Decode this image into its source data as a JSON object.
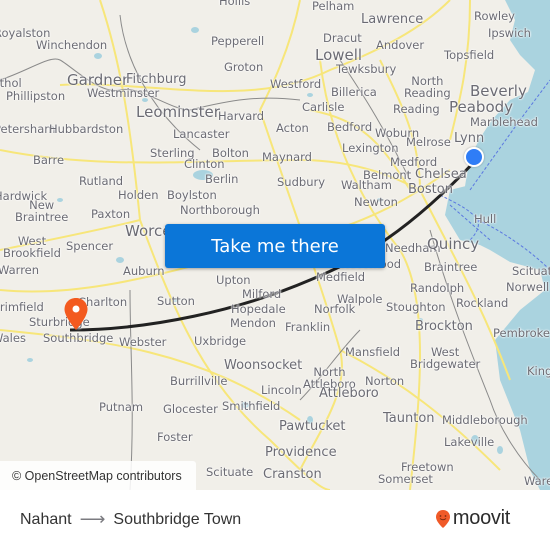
{
  "map": {
    "attribution": "© OpenStreetMap contributors",
    "origin": {
      "name": "Nahant",
      "marker": "blue-dot",
      "color": "#2f7df6"
    },
    "destination": {
      "name": "Southbridge Town",
      "marker": "orange-pin",
      "color": "#f35a1f"
    },
    "route_color": "#222222",
    "water_color": "#aad3df",
    "places": [
      {
        "id": "hollis",
        "label": "Hollis"
      },
      {
        "id": "pelham",
        "label": "Pelham"
      },
      {
        "id": "lawrence",
        "label": "Lawrence"
      },
      {
        "id": "rowley",
        "label": "Rowley"
      },
      {
        "id": "royalston",
        "label": "Royalston"
      },
      {
        "id": "winchendon",
        "label": "Winchendon"
      },
      {
        "id": "pepperell",
        "label": "Pepperell"
      },
      {
        "id": "dracut",
        "label": "Dracut"
      },
      {
        "id": "andover",
        "label": "Andover"
      },
      {
        "id": "ipswich",
        "label": "Ipswich"
      },
      {
        "id": "topsfield",
        "label": "Topsfield"
      },
      {
        "id": "lowell",
        "label": "Lowell"
      },
      {
        "id": "tewksbury",
        "label": "Tewksbury"
      },
      {
        "id": "groton",
        "label": "Groton"
      },
      {
        "id": "gardner",
        "label": "Gardner"
      },
      {
        "id": "fitchburg",
        "label": "Fitchburg"
      },
      {
        "id": "athol",
        "label": "Athol"
      },
      {
        "id": "westminster",
        "label": "Westminster"
      },
      {
        "id": "phillipston",
        "label": "Phillipston"
      },
      {
        "id": "westford",
        "label": "Westford"
      },
      {
        "id": "north-reading",
        "label": "North Reading"
      },
      {
        "id": "billerica",
        "label": "Billerica"
      },
      {
        "id": "beverly",
        "label": "Beverly"
      },
      {
        "id": "peabody",
        "label": "Peabody"
      },
      {
        "id": "carlisle",
        "label": "Carlisle"
      },
      {
        "id": "reading",
        "label": "Reading"
      },
      {
        "id": "leominster",
        "label": "Leominster"
      },
      {
        "id": "harvard",
        "label": "Harvard"
      },
      {
        "id": "marblehead",
        "label": "Marblehead"
      },
      {
        "id": "petersham",
        "label": "Petersham"
      },
      {
        "id": "hubbardston",
        "label": "Hubbardston"
      },
      {
        "id": "lancaster",
        "label": "Lancaster"
      },
      {
        "id": "acton",
        "label": "Acton"
      },
      {
        "id": "bedford",
        "label": "Bedford"
      },
      {
        "id": "woburn",
        "label": "Woburn"
      },
      {
        "id": "lynn",
        "label": "Lynn"
      },
      {
        "id": "melrose",
        "label": "Melrose"
      },
      {
        "id": "lexington",
        "label": "Lexington"
      },
      {
        "id": "sterling",
        "label": "Sterling"
      },
      {
        "id": "bolton",
        "label": "Bolton"
      },
      {
        "id": "barre",
        "label": "Barre"
      },
      {
        "id": "clinton",
        "label": "Clinton"
      },
      {
        "id": "maynard",
        "label": "Maynard"
      },
      {
        "id": "medford",
        "label": "Medford"
      },
      {
        "id": "belmont",
        "label": "Belmont"
      },
      {
        "id": "chelsea",
        "label": "Chelsea"
      },
      {
        "id": "berlin",
        "label": "Berlin"
      },
      {
        "id": "rutland",
        "label": "Rutland"
      },
      {
        "id": "sudbury",
        "label": "Sudbury"
      },
      {
        "id": "waltham",
        "label": "Waltham"
      },
      {
        "id": "boston",
        "label": "Boston"
      },
      {
        "id": "hardwick",
        "label": "Hardwick"
      },
      {
        "id": "holden",
        "label": "Holden"
      },
      {
        "id": "boylston",
        "label": "Boylston"
      },
      {
        "id": "new-braintree",
        "label": "New Braintree"
      },
      {
        "id": "newton",
        "label": "Newton"
      },
      {
        "id": "northborough",
        "label": "Northborough"
      },
      {
        "id": "paxton",
        "label": "Paxton"
      },
      {
        "id": "hull",
        "label": "Hull"
      },
      {
        "id": "worcester",
        "label": "Worcester"
      },
      {
        "id": "west-brookfield",
        "label": "West Brookfield"
      },
      {
        "id": "spencer",
        "label": "Spencer"
      },
      {
        "id": "needham",
        "label": "Needham"
      },
      {
        "id": "quincy",
        "label": "Quincy"
      },
      {
        "id": "warren",
        "label": "Warren"
      },
      {
        "id": "auburn",
        "label": "Auburn"
      },
      {
        "id": "upton",
        "label": "Upton"
      },
      {
        "id": "westwood",
        "label": "Westwood"
      },
      {
        "id": "braintree",
        "label": "Braintree"
      },
      {
        "id": "scituate",
        "label": "Scituate"
      },
      {
        "id": "medfield",
        "label": "Medfield"
      },
      {
        "id": "randolph",
        "label": "Randolph"
      },
      {
        "id": "norwell",
        "label": "Norwell"
      },
      {
        "id": "brimfield",
        "label": "Brimfield"
      },
      {
        "id": "charlton",
        "label": "Charlton"
      },
      {
        "id": "sutton",
        "label": "Sutton"
      },
      {
        "id": "milford",
        "label": "Milford"
      },
      {
        "id": "walpole",
        "label": "Walpole"
      },
      {
        "id": "hopedale",
        "label": "Hopedale"
      },
      {
        "id": "norfolk",
        "label": "Norfolk"
      },
      {
        "id": "stoughton",
        "label": "Stoughton"
      },
      {
        "id": "rockland",
        "label": "Rockland"
      },
      {
        "id": "sturbridge",
        "label": "Sturbridge"
      },
      {
        "id": "mendon",
        "label": "Mendon"
      },
      {
        "id": "franklin",
        "label": "Franklin"
      },
      {
        "id": "brockton",
        "label": "Brockton"
      },
      {
        "id": "pembroke",
        "label": "Pembroke"
      },
      {
        "id": "wales",
        "label": "Wales"
      },
      {
        "id": "southbridge",
        "label": "Southbridge"
      },
      {
        "id": "webster",
        "label": "Webster"
      },
      {
        "id": "uxbridge",
        "label": "Uxbridge"
      },
      {
        "id": "mansfield",
        "label": "Mansfield"
      },
      {
        "id": "west-bridgewater",
        "label": "West Bridgewater"
      },
      {
        "id": "kingston",
        "label": "Kingston"
      },
      {
        "id": "woonsocket",
        "label": "Woonsocket"
      },
      {
        "id": "north-attleboro",
        "label": "North Attleboro"
      },
      {
        "id": "norton",
        "label": "Norton"
      },
      {
        "id": "burrillville",
        "label": "Burrillville"
      },
      {
        "id": "lincoln",
        "label": "Lincoln"
      },
      {
        "id": "attleboro",
        "label": "Attleboro"
      },
      {
        "id": "putnam",
        "label": "Putnam"
      },
      {
        "id": "glocester",
        "label": "Glocester"
      },
      {
        "id": "smithfield",
        "label": "Smithfield"
      },
      {
        "id": "taunton",
        "label": "Taunton"
      },
      {
        "id": "middleborough",
        "label": "Middleborough"
      },
      {
        "id": "pawtucket",
        "label": "Pawtucket"
      },
      {
        "id": "foster",
        "label": "Foster"
      },
      {
        "id": "lakeville",
        "label": "Lakeville"
      },
      {
        "id": "providence",
        "label": "Providence"
      },
      {
        "id": "freetown",
        "label": "Freetown"
      },
      {
        "id": "scituate-ri",
        "label": "Scituate"
      },
      {
        "id": "cranston",
        "label": "Cranston"
      },
      {
        "id": "somerset",
        "label": "Somerset"
      },
      {
        "id": "wareham",
        "label": "Wareham"
      }
    ]
  },
  "cta": {
    "label": "Take me there"
  },
  "footer": {
    "origin": "Nahant",
    "arrow_icon": "arrow-right-icon",
    "destination": "Southbridge Town",
    "brand": "moovit",
    "brand_color": "#f05a28"
  }
}
